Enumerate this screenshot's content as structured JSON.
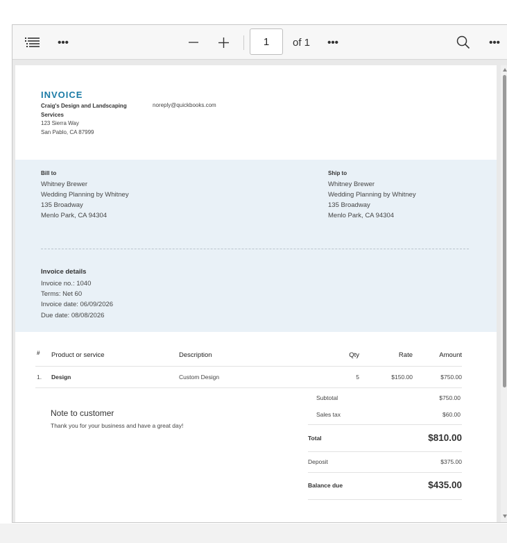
{
  "toolbar": {
    "page_number": "1",
    "page_of": "of 1"
  },
  "invoice": {
    "title": "INVOICE",
    "company_name": "Craig's Design and Landscaping Services",
    "company_street": "123 Sierra Way",
    "company_city": "San Pablo, CA 87999",
    "email": "noreply@quickbooks.com"
  },
  "bill_to": {
    "label": "Bill to",
    "name": "Whitney Brewer",
    "company": "Wedding Planning by Whitney",
    "street": "135 Broadway",
    "city": "Menlo Park, CA 94304"
  },
  "ship_to": {
    "label": "Ship to",
    "name": "Whitney Brewer",
    "company": "Wedding Planning by Whitney",
    "street": "135 Broadway",
    "city": "Menlo Park, CA 94304"
  },
  "details": {
    "title": "Invoice details",
    "number": "Invoice no.: 1040",
    "terms": "Terms: Net 60",
    "date": "Invoice date: 06/09/2026",
    "due": "Due date: 08/08/2026"
  },
  "table": {
    "headers": {
      "num": "#",
      "product": "Product or service",
      "description": "Description",
      "qty": "Qty",
      "rate": "Rate",
      "amount": "Amount"
    },
    "rows": [
      {
        "num": "1.",
        "product": "Design",
        "description": "Custom Design",
        "qty": "5",
        "rate": "$150.00",
        "amount": "$750.00"
      }
    ]
  },
  "note": {
    "title": "Note to customer",
    "text": "Thank you for your business and have a great day!"
  },
  "totals": {
    "subtotal_label": "Subtotal",
    "subtotal": "$750.00",
    "tax_label": "Sales tax",
    "tax": "$60.00",
    "total_label": "Total",
    "total": "$810.00",
    "deposit_label": "Deposit",
    "deposit": "$375.00",
    "balance_label": "Balance due",
    "balance": "$435.00"
  }
}
